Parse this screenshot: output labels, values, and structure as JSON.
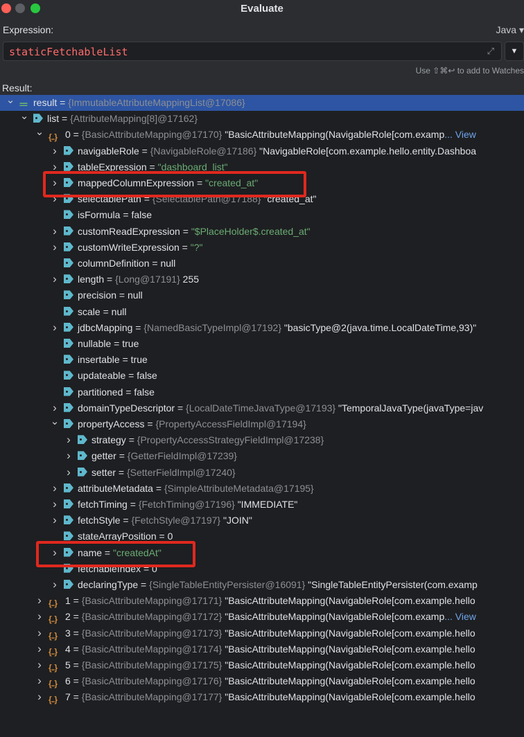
{
  "window": {
    "title": "Evaluate"
  },
  "expression": {
    "label": "Expression:",
    "value": "staticFetchableList",
    "language": "Java ▾",
    "watch_hint": "Use ⇧⌘↩ to add to Watches"
  },
  "result": {
    "label": "Result:",
    "rows": [
      {
        "indent": 0,
        "chevron": "open",
        "icon": "result",
        "name": "result",
        "ref": "{ImmutableAttributeMappingList@17086}",
        "value": "",
        "selected": true
      },
      {
        "indent": 1,
        "chevron": "open",
        "icon": "tag",
        "name": "list",
        "ref": "{AttributeMapping[8]@17162}",
        "value": ""
      },
      {
        "indent": 2,
        "chevron": "open",
        "icon": "array",
        "name": "0",
        "ref": "{BasicAttributeMapping@17170}",
        "value": "\"BasicAttributeMapping(NavigableRole[com.examp",
        "view": "... View"
      },
      {
        "indent": 3,
        "chevron": "closed",
        "icon": "tag",
        "name": "navigableRole",
        "ref": "{NavigableRole@17186}",
        "value": "\"NavigableRole[com.example.hello.entity.Dashboa"
      },
      {
        "indent": 3,
        "chevron": "closed",
        "icon": "tag",
        "name": "tableExpression",
        "ref": "",
        "value": "\"dashboard_list\"",
        "valtype": "str"
      },
      {
        "indent": 3,
        "chevron": "closed",
        "icon": "tag",
        "name": "mappedColumnExpression",
        "ref": "",
        "value": "\"created_at\"",
        "valtype": "str"
      },
      {
        "indent": 3,
        "chevron": "closed",
        "icon": "tag",
        "name": "selectablePath",
        "ref": "{SelectablePath@17188}",
        "value": "\"created_at\""
      },
      {
        "indent": 3,
        "chevron": "none",
        "icon": "tag",
        "name": "isFormula",
        "ref": "",
        "value": "false"
      },
      {
        "indent": 3,
        "chevron": "closed",
        "icon": "tag",
        "name": "customReadExpression",
        "ref": "",
        "value": "\"$PlaceHolder$.created_at\"",
        "valtype": "str"
      },
      {
        "indent": 3,
        "chevron": "closed",
        "icon": "tag",
        "name": "customWriteExpression",
        "ref": "",
        "value": "\"?\"",
        "valtype": "str"
      },
      {
        "indent": 3,
        "chevron": "none",
        "icon": "tag",
        "name": "columnDefinition",
        "ref": "",
        "value": "null"
      },
      {
        "indent": 3,
        "chevron": "closed",
        "icon": "tag",
        "name": "length",
        "ref": "{Long@17191}",
        "value": "255"
      },
      {
        "indent": 3,
        "chevron": "none",
        "icon": "tag",
        "name": "precision",
        "ref": "",
        "value": "null"
      },
      {
        "indent": 3,
        "chevron": "none",
        "icon": "tag",
        "name": "scale",
        "ref": "",
        "value": "null"
      },
      {
        "indent": 3,
        "chevron": "closed",
        "icon": "tag",
        "name": "jdbcMapping",
        "ref": "{NamedBasicTypeImpl@17192}",
        "value": "\"basicType@2(java.time.LocalDateTime,93)\""
      },
      {
        "indent": 3,
        "chevron": "none",
        "icon": "tag",
        "name": "nullable",
        "ref": "",
        "value": "true"
      },
      {
        "indent": 3,
        "chevron": "none",
        "icon": "tag",
        "name": "insertable",
        "ref": "",
        "value": "true"
      },
      {
        "indent": 3,
        "chevron": "none",
        "icon": "tag",
        "name": "updateable",
        "ref": "",
        "value": "false"
      },
      {
        "indent": 3,
        "chevron": "none",
        "icon": "tag",
        "name": "partitioned",
        "ref": "",
        "value": "false"
      },
      {
        "indent": 3,
        "chevron": "closed",
        "icon": "tag",
        "name": "domainTypeDescriptor",
        "ref": "{LocalDateTimeJavaType@17193}",
        "value": "\"TemporalJavaType(javaType=jav"
      },
      {
        "indent": 3,
        "chevron": "open",
        "icon": "tag",
        "name": "propertyAccess",
        "ref": "{PropertyAccessFieldImpl@17194}",
        "value": ""
      },
      {
        "indent": 4,
        "chevron": "closed",
        "icon": "tag",
        "name": "strategy",
        "ref": "{PropertyAccessStrategyFieldImpl@17238}",
        "value": ""
      },
      {
        "indent": 4,
        "chevron": "closed",
        "icon": "tag",
        "name": "getter",
        "ref": "{GetterFieldImpl@17239}",
        "value": ""
      },
      {
        "indent": 4,
        "chevron": "closed",
        "icon": "tag",
        "name": "setter",
        "ref": "{SetterFieldImpl@17240}",
        "value": ""
      },
      {
        "indent": 3,
        "chevron": "closed",
        "icon": "tag",
        "name": "attributeMetadata",
        "ref": "{SimpleAttributeMetadata@17195}",
        "value": ""
      },
      {
        "indent": 3,
        "chevron": "closed",
        "icon": "tag",
        "name": "fetchTiming",
        "ref": "{FetchTiming@17196}",
        "value": "\"IMMEDIATE\""
      },
      {
        "indent": 3,
        "chevron": "closed",
        "icon": "tag",
        "name": "fetchStyle",
        "ref": "{FetchStyle@17197}",
        "value": "\"JOIN\""
      },
      {
        "indent": 3,
        "chevron": "none",
        "icon": "tag",
        "name": "stateArrayPosition",
        "ref": "",
        "value": "0"
      },
      {
        "indent": 3,
        "chevron": "closed",
        "icon": "tag",
        "name": "name",
        "ref": "",
        "value": "\"createdAt\"",
        "valtype": "str"
      },
      {
        "indent": 3,
        "chevron": "none",
        "icon": "tag",
        "name": "fetchableIndex",
        "ref": "",
        "value": "0"
      },
      {
        "indent": 3,
        "chevron": "closed",
        "icon": "tag",
        "name": "declaringType",
        "ref": "{SingleTableEntityPersister@16091}",
        "value": "\"SingleTableEntityPersister(com.examp"
      },
      {
        "indent": 2,
        "chevron": "closed",
        "icon": "array",
        "name": "1",
        "ref": "{BasicAttributeMapping@17171}",
        "value": "\"BasicAttributeMapping(NavigableRole[com.example.hello"
      },
      {
        "indent": 2,
        "chevron": "closed",
        "icon": "array",
        "name": "2",
        "ref": "{BasicAttributeMapping@17172}",
        "value": "\"BasicAttributeMapping(NavigableRole[com.examp",
        "view": "... View"
      },
      {
        "indent": 2,
        "chevron": "closed",
        "icon": "array",
        "name": "3",
        "ref": "{BasicAttributeMapping@17173}",
        "value": "\"BasicAttributeMapping(NavigableRole[com.example.hello"
      },
      {
        "indent": 2,
        "chevron": "closed",
        "icon": "array",
        "name": "4",
        "ref": "{BasicAttributeMapping@17174}",
        "value": "\"BasicAttributeMapping(NavigableRole[com.example.hello"
      },
      {
        "indent": 2,
        "chevron": "closed",
        "icon": "array",
        "name": "5",
        "ref": "{BasicAttributeMapping@17175}",
        "value": "\"BasicAttributeMapping(NavigableRole[com.example.hello"
      },
      {
        "indent": 2,
        "chevron": "closed",
        "icon": "array",
        "name": "6",
        "ref": "{BasicAttributeMapping@17176}",
        "value": "\"BasicAttributeMapping(NavigableRole[com.example.hello"
      },
      {
        "indent": 2,
        "chevron": "closed",
        "icon": "array",
        "name": "7",
        "ref": "{BasicAttributeMapping@17177}",
        "value": "\"BasicAttributeMapping(NavigableRole[com.example.hello"
      }
    ]
  },
  "colors": {
    "background": "#2b2d30",
    "tree_background": "#1e1f22",
    "selection": "#2e55a3",
    "string_value": "#6aab73",
    "reference": "#8c8f94",
    "highlight_box": "#e0281e",
    "tag_icon": "#5fb8cc",
    "array_icon": "#d08a3c"
  }
}
